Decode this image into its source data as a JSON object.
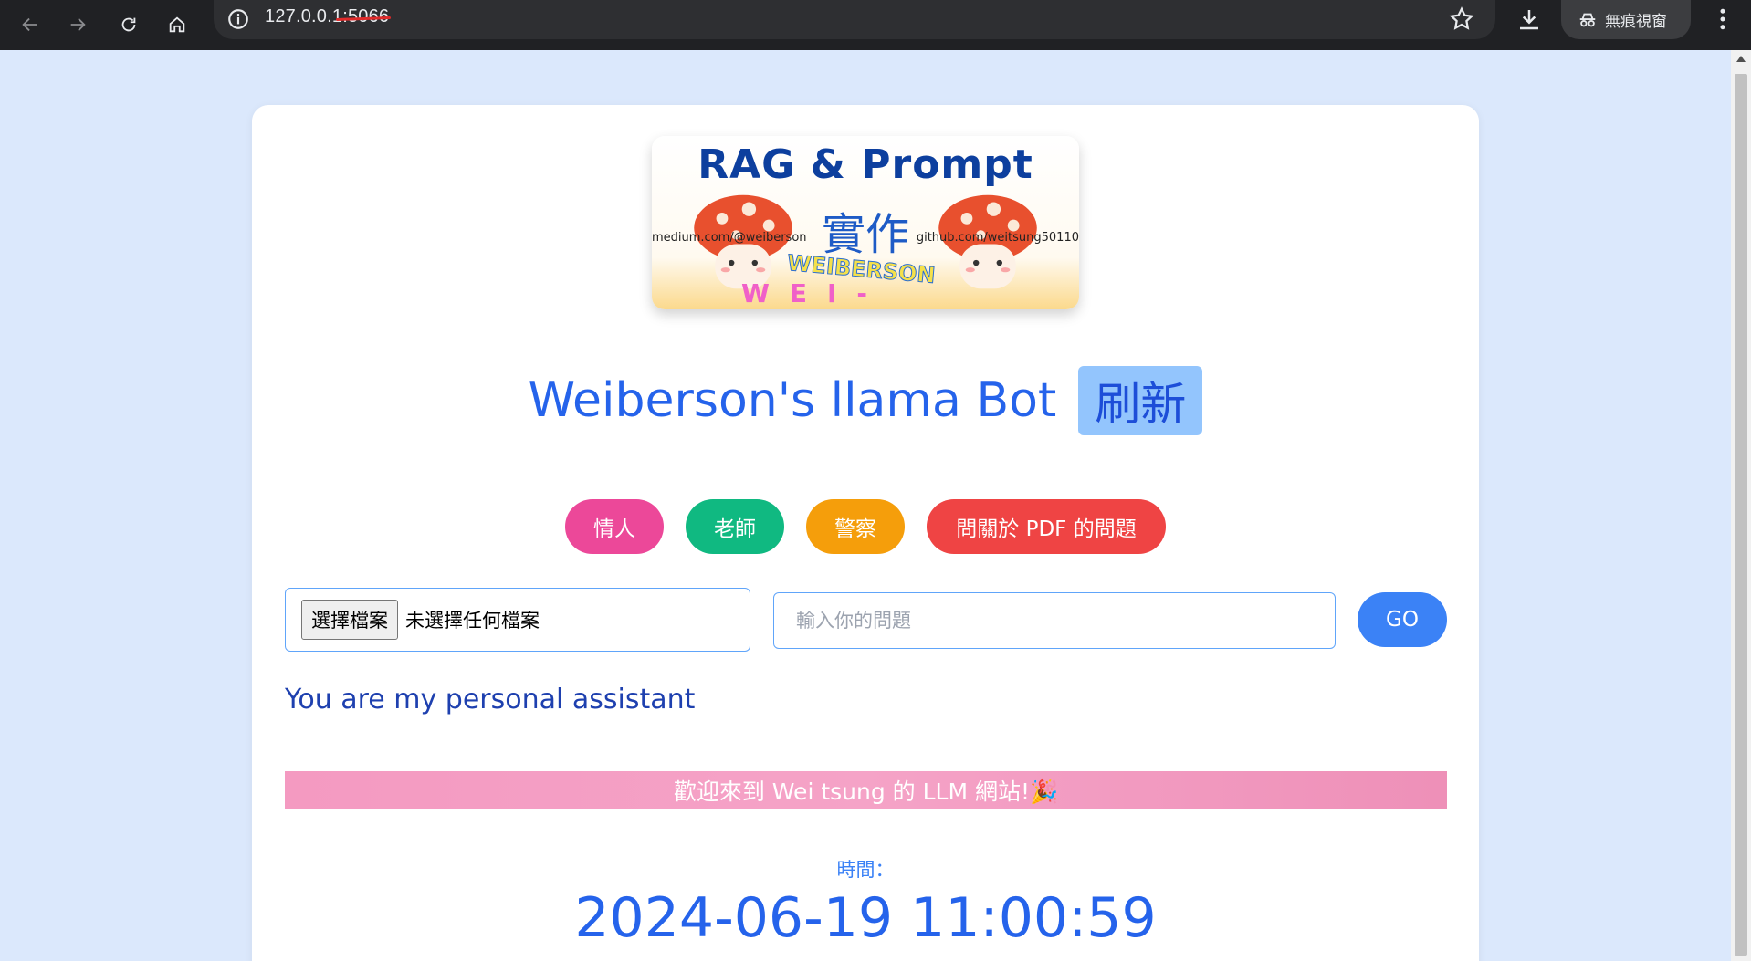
{
  "browser": {
    "url": "127.0.0.1:5066",
    "incognito_label": "無痕視窗"
  },
  "banner": {
    "title": "RAG & Prompt",
    "subtitle": "實作",
    "medium_text": "medium.com/@weiberson",
    "github_text": "github.com/weitsung50110",
    "signature_1": "WEIBERSON",
    "signature_2": "WEI-TSUNG"
  },
  "header": {
    "title": "Weiberson's llama Bot",
    "refresh_label": "刷新"
  },
  "roles": [
    {
      "label": "情人",
      "color": "#ec4899"
    },
    {
      "label": "老師",
      "color": "#10b981"
    },
    {
      "label": "警察",
      "color": "#f59e0b"
    },
    {
      "label": "問關於 PDF 的問題",
      "color": "#ef4444"
    }
  ],
  "form": {
    "file_button_label": "選擇檔案",
    "file_status": "未選擇任何檔案",
    "question_placeholder": "輸入你的問題",
    "go_label": "GO"
  },
  "assistant_prompt": "You are my personal assistant",
  "welcome_text": "歡迎來到 Wei tsung 的 LLM 網站!🎉",
  "time": {
    "label": "時間：",
    "value": "2024-06-19 11:00:59"
  }
}
